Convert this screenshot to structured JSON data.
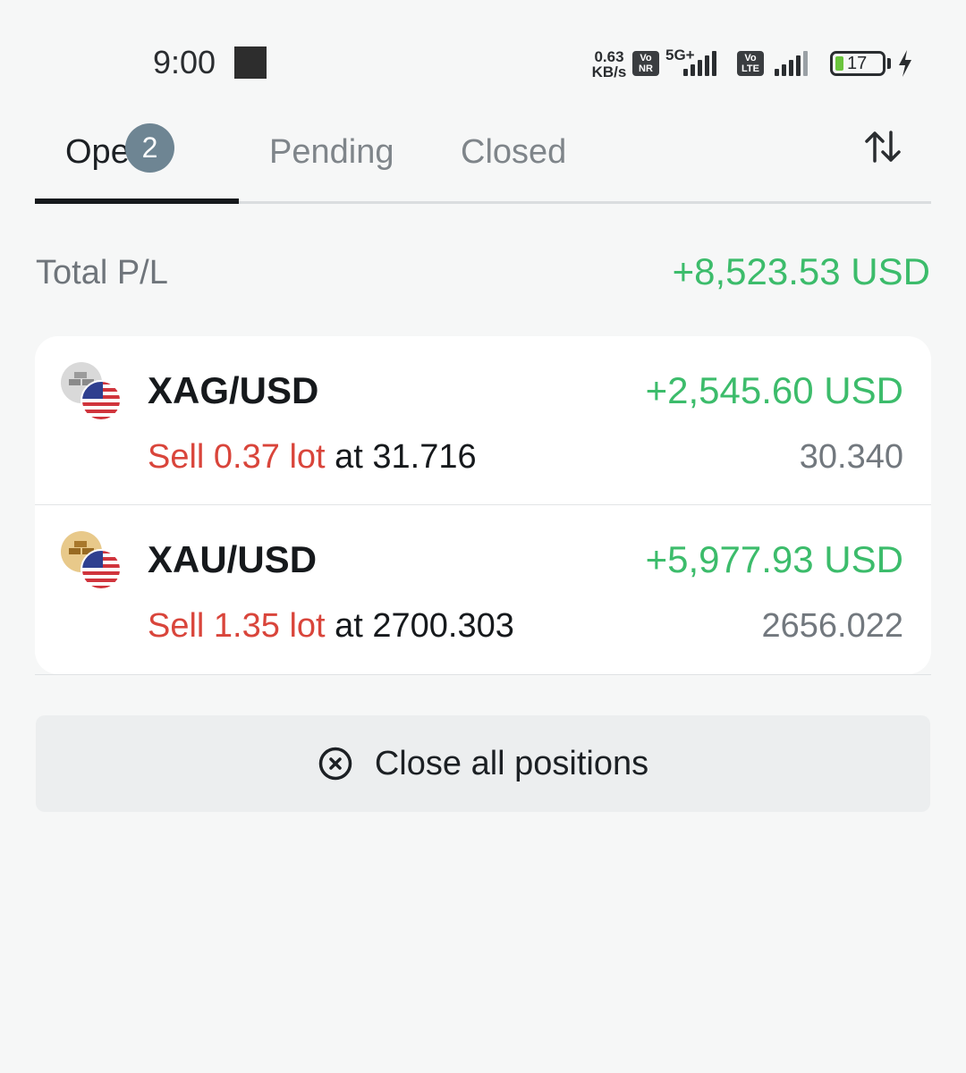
{
  "status_bar": {
    "time": "9:00",
    "net_speed_value": "0.63",
    "net_speed_unit": "KB/s",
    "sim1_tag_top": "Vo",
    "sim1_tag_bottom": "NR",
    "sim1_generation": "5G+",
    "sim2_tag_top": "Vo",
    "sim2_tag_bottom": "LTE",
    "battery_level": "17",
    "battery_color": "#6ac43c",
    "charging": true
  },
  "tabs": {
    "items": [
      {
        "label": "Open",
        "active": true
      },
      {
        "label": "Pending",
        "active": false
      },
      {
        "label": "Closed",
        "active": false
      }
    ],
    "open_count": "2",
    "sort_icon": "sort-arrows-icon"
  },
  "summary": {
    "total_label": "Total P/L",
    "total_value": "+8,523.53 USD"
  },
  "positions": [
    {
      "pair": "XAG/USD",
      "icon": "silver-usd-icon",
      "pl": "+2,545.60 USD",
      "side_text": "Sell 0.37 lot",
      "at_text": " at 31.716",
      "current_price": "30.340"
    },
    {
      "pair": "XAU/USD",
      "icon": "gold-usd-icon",
      "pl": "+5,977.93 USD",
      "side_text": "Sell 1.35 lot",
      "at_text": " at 2700.303",
      "current_price": "2656.022"
    }
  ],
  "actions": {
    "close_all_label": "Close all positions",
    "close_all_icon": "close-circle-icon"
  },
  "colors": {
    "profit": "#3cbc6b",
    "sell": "#d9453b",
    "badge": "#6e8593",
    "background": "#f6f7f7"
  }
}
